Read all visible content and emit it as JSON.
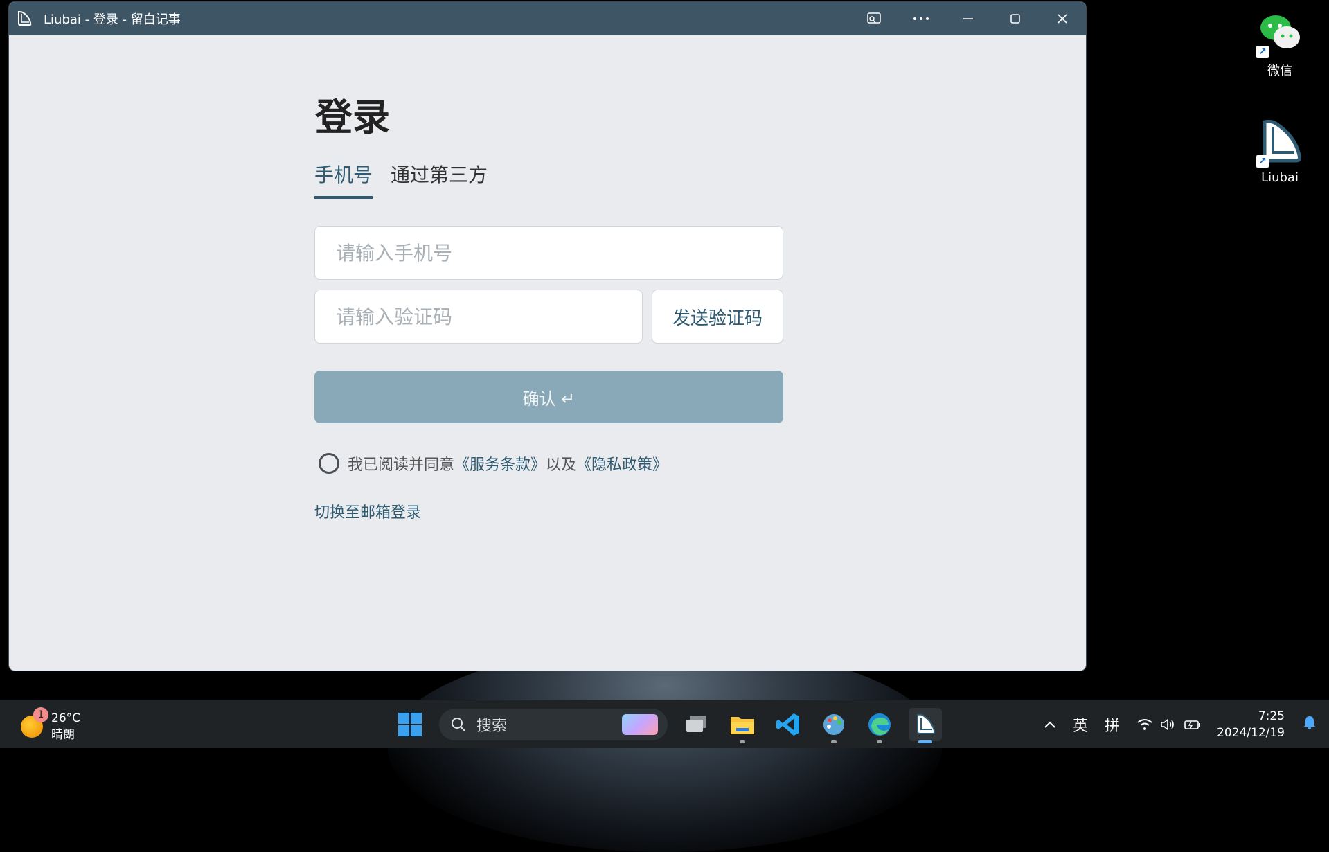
{
  "window": {
    "title": "Liubai - 登录 - 留白记事"
  },
  "login": {
    "heading": "登录",
    "tabs": [
      {
        "label": "手机号",
        "active": true
      },
      {
        "label": "通过第三方",
        "active": false
      }
    ],
    "phone_placeholder": "请输入手机号",
    "code_placeholder": "请输入验证码",
    "send_code_label": "发送验证码",
    "confirm_label": "确认 ↵",
    "agree_prefix": "我已阅读并同意",
    "terms_link": "《服务条款》",
    "agree_middle": "以及",
    "privacy_link": "《隐私政策》",
    "switch_email": "切换至邮箱登录"
  },
  "desktop": {
    "icons": [
      {
        "label": "微信",
        "icon": "wechat-icon"
      },
      {
        "label": "Liubai",
        "icon": "liubai-icon"
      }
    ]
  },
  "taskbar": {
    "weather": {
      "temp": "26°C",
      "condition": "晴朗",
      "badge": "1"
    },
    "search_label": "搜索",
    "ime_lang": "英",
    "ime_mode": "拼",
    "time": "7:25",
    "date": "2024/12/19"
  },
  "colors": {
    "accent": "#2f5b72",
    "titlebar": "#3e5565",
    "confirm": "#8aa9b8"
  }
}
